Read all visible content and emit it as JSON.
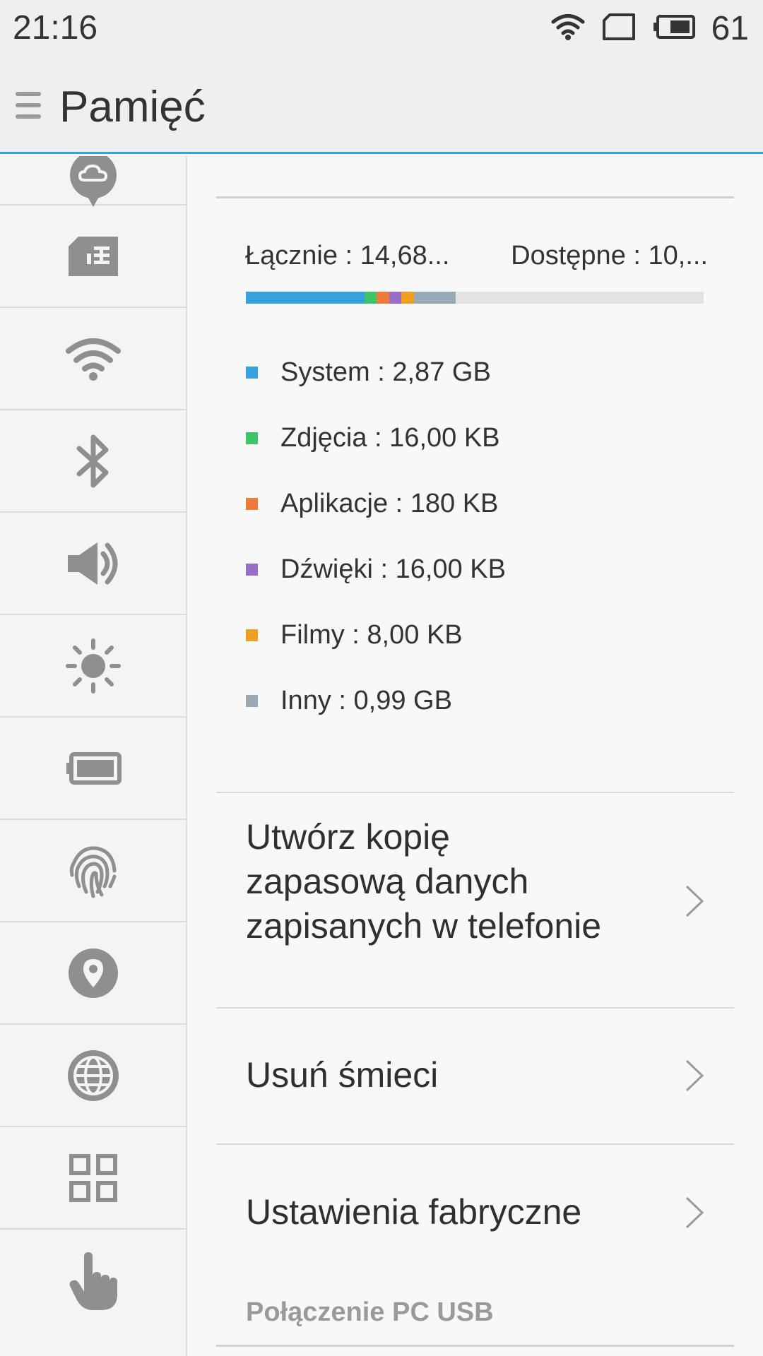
{
  "status_bar": {
    "time": "21:16",
    "battery_percent": "61",
    "icons": [
      "wifi-icon",
      "sim-card-icon",
      "battery-icon"
    ]
  },
  "header": {
    "title": "Pamięć",
    "menu_icon": "menu-icon"
  },
  "sidebar": {
    "items": [
      {
        "icon": "cloud-pin-icon"
      },
      {
        "icon": "sim-card-icon"
      },
      {
        "icon": "wifi-icon"
      },
      {
        "icon": "bluetooth-icon"
      },
      {
        "icon": "speaker-icon"
      },
      {
        "icon": "brightness-icon"
      },
      {
        "icon": "battery-icon"
      },
      {
        "icon": "fingerprint-icon"
      },
      {
        "icon": "location-pin-icon"
      },
      {
        "icon": "globe-icon"
      },
      {
        "icon": "apps-grid-icon"
      },
      {
        "icon": "hand-pointer-icon"
      }
    ]
  },
  "storage": {
    "total_label": "Łącznie : 14,68...",
    "available_label": "Dostępne : 10,...",
    "usage_bar": [
      {
        "name": "System",
        "fraction": 0.26,
        "color": "#36a3e0"
      },
      {
        "name": "Zdjęcia",
        "fraction": 0.026,
        "color": "#3cc46a"
      },
      {
        "name": "Aplikacje",
        "fraction": 0.028,
        "color": "#f07a3a"
      },
      {
        "name": "Dźwięki",
        "fraction": 0.026,
        "color": "#9a6ec8"
      },
      {
        "name": "Filmy",
        "fraction": 0.028,
        "color": "#f0a020"
      },
      {
        "name": "Inny",
        "fraction": 0.09,
        "color": "#98aab8"
      }
    ],
    "legend": [
      {
        "label": "System : 2,87 GB",
        "color": "#36a3e0"
      },
      {
        "label": "Zdjęcia : 16,00 KB",
        "color": "#3cc46a"
      },
      {
        "label": "Aplikacje : 180 KB",
        "color": "#f07a3a"
      },
      {
        "label": "Dźwięki : 16,00 KB",
        "color": "#9a6ec8"
      },
      {
        "label": "Filmy : 8,00 KB",
        "color": "#f0a020"
      },
      {
        "label": "Inny : 0,99 GB",
        "color": "#98aab8"
      }
    ]
  },
  "actions": {
    "backup": "Utwórz kopię zapasową danych zapisanych w telefonie",
    "clean": "Usuń śmieci",
    "factory": "Ustawienia fabryczne"
  },
  "section_usb": "Połączenie PC USB",
  "colors": {
    "accent": "#3aa0d8",
    "icon_gray": "#8f8f8f"
  }
}
